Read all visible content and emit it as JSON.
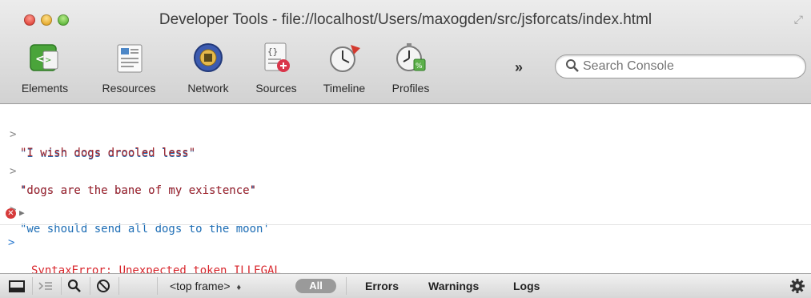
{
  "window": {
    "title": "Developer Tools - file://localhost/Users/maxogden/src/jsforcats/index.html"
  },
  "toolbar": {
    "tabs": [
      {
        "label": "Elements",
        "icon": "elements-icon"
      },
      {
        "label": "Resources",
        "icon": "resources-icon"
      },
      {
        "label": "Network",
        "icon": "network-icon"
      },
      {
        "label": "Sources",
        "icon": "sources-icon"
      },
      {
        "label": "Timeline",
        "icon": "timeline-icon"
      },
      {
        "label": "Profiles",
        "icon": "profiles-icon"
      }
    ],
    "overflow_label": "»",
    "search_placeholder": "Search Console"
  },
  "console": {
    "prompt_symbol": ">",
    "lines": [
      {
        "type": "command",
        "text": "\"I wish dogs drooled less\""
      },
      {
        "type": "result",
        "text": "\"I wish dogs drooled less\""
      },
      {
        "type": "command",
        "text": "'dogs are the bane of my existence'"
      },
      {
        "type": "result",
        "text": "\"dogs are the bane of my existence\""
      },
      {
        "type": "command",
        "text": "\"we should send all dogs to the moon'"
      },
      {
        "type": "error",
        "text": "SyntaxError: Unexpected token ILLEGAL"
      }
    ]
  },
  "statusbar": {
    "frame_select": "<top frame>",
    "frame_arrows": "♦",
    "filters": {
      "all": "All",
      "errors": "Errors",
      "warnings": "Warnings",
      "logs": "Logs"
    }
  },
  "colors": {
    "command": "#1d6db5",
    "result": "#a8272c",
    "error": "#d8262c",
    "prompt_caret": "#2d7bd0"
  }
}
